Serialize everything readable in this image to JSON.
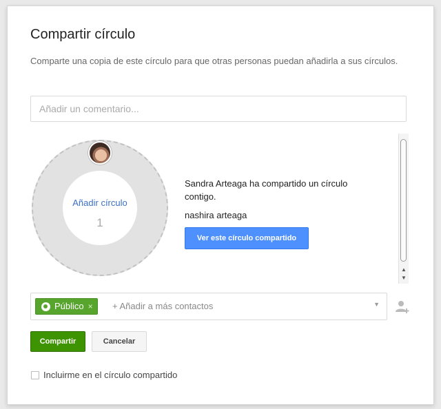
{
  "dialog": {
    "title": "Compartir círculo",
    "subtitle": "Comparte una copia de este círculo para que otras personas puedan añadirla a sus círculos.",
    "comment": {
      "placeholder": "Añadir un comentario...",
      "value": ""
    }
  },
  "preview": {
    "add_circle_label": "Añadir círculo",
    "circle_count": "1",
    "share_message": "Sandra Arteaga ha compartido un círculo contigo.",
    "owner_name": "nashira arteaga",
    "view_button_label": "Ver este círculo compartido"
  },
  "recipients": {
    "chip_label": "Público",
    "chip_remove": "×",
    "add_more_placeholder": "+ Añadir a más contactos"
  },
  "actions": {
    "share_label": "Compartir",
    "cancel_label": "Cancelar"
  },
  "options": {
    "include_me_label": "Incluirme en el círculo compartido",
    "include_me_checked": false
  },
  "colors": {
    "primary_blue": "#4d90fe",
    "share_green": "#3d9400",
    "chip_green": "#58a52e",
    "link_blue": "#3b6fc5"
  },
  "icons": {
    "chip": "globe-icon",
    "add_person": "add-person-icon",
    "dropdown": "chevron-down-icon",
    "scroll_up": "scroll-up-arrow-icon",
    "scroll_down": "scroll-down-arrow-icon"
  }
}
